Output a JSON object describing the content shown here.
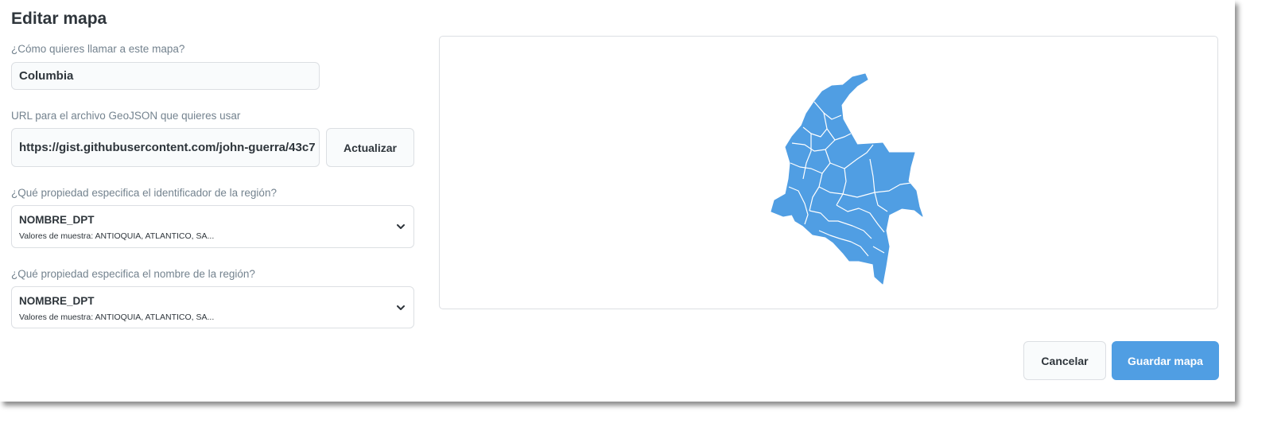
{
  "modal": {
    "title": "Editar mapa"
  },
  "form": {
    "name_label": "¿Cómo quieres llamar a este mapa?",
    "name_value": "Columbia",
    "url_label": "URL para el archivo GeoJSON que quieres usar",
    "url_value": "https://gist.githubusercontent.com/john-guerra/43c7",
    "refresh_label": "Actualizar",
    "id_label": "¿Qué propiedad especifica el identificador de la región?",
    "id_value": "NOMBRE_DPT",
    "id_sample": "Valores de muestra: ANTIOQUIA, ATLANTICO, SA...",
    "name_prop_label": "¿Qué propiedad especifica el nombre de la región?",
    "name_prop_value": "NOMBRE_DPT",
    "name_prop_sample": "Valores de muestra: ANTIOQUIA, ATLANTICO, SA..."
  },
  "map": {
    "fill_color": "#509ee3",
    "border_color": "#ffffff"
  },
  "footer": {
    "cancel_label": "Cancelar",
    "save_label": "Guardar mapa"
  },
  "colors": {
    "primary": "#509ee3",
    "text": "#2e353b",
    "muted": "#74838f",
    "border": "#dcdfe3"
  }
}
